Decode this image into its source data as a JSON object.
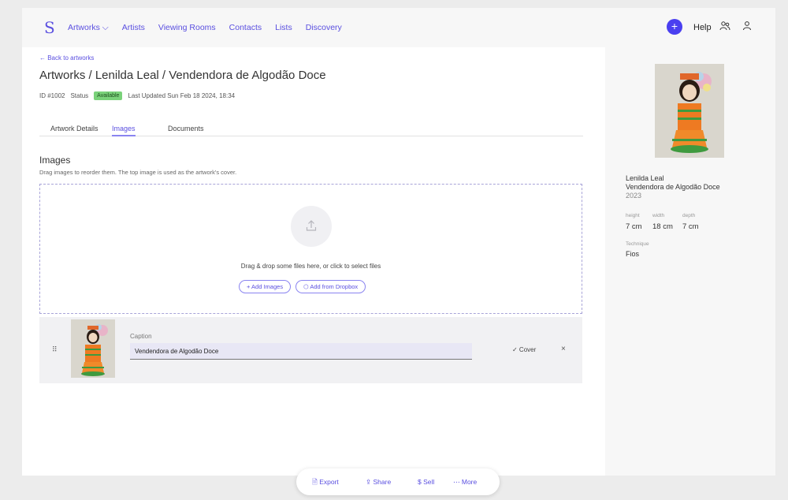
{
  "nav": {
    "logo": "S",
    "items": [
      "Artworks",
      "Artists",
      "Viewing Rooms",
      "Contacts",
      "Lists",
      "Discovery"
    ],
    "help": "Help"
  },
  "page": {
    "back_link": "← Back to artworks",
    "title": "Artworks / Lenilda Leal / Vendendora de Algodão Doce",
    "id": "ID #1002",
    "status_label": "Status",
    "status_badge": "Available",
    "last_updated": "Last Updated Sun Feb 18 2024, 18:34"
  },
  "tabs": [
    "Artwork Details",
    "Images",
    "Documents"
  ],
  "images_section": {
    "title": "Images",
    "description": "Drag images to reorder them. The top image is used as the artwork's cover.",
    "drop_text": "Drag & drop some files here, or click to select files",
    "add_images": "+ Add Images",
    "add_dropbox": "Add from Dropbox"
  },
  "image_row": {
    "caption_label": "Caption",
    "caption_value": "Vendendora de Algodão Doce",
    "cover_label": "✓ Cover",
    "remove": "×"
  },
  "side": {
    "artist": "Lenilda Leal",
    "work": "Vendendora de Algodão Doce",
    "year": "2023",
    "height_label": "height",
    "width_label": "width",
    "depth_label": "depth",
    "height": "7 cm",
    "width": "18 cm",
    "depth": "7 cm",
    "technique_label": "Technique",
    "technique": "Fios"
  },
  "actions": {
    "export": "Export",
    "share": "Share",
    "sell": "Sell",
    "more": "More"
  },
  "colors": {
    "accent": "#5a4fe0",
    "badge": "#7ad27a"
  }
}
